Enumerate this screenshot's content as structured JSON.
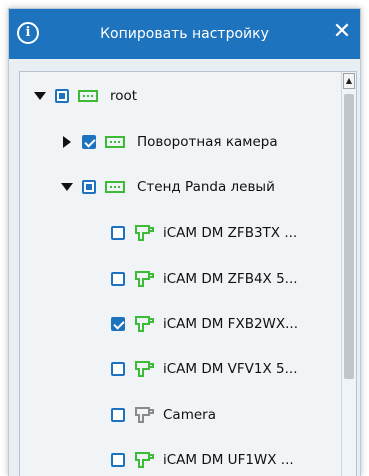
{
  "dialog": {
    "title": "Копировать настройку",
    "info_icon": "info-icon",
    "close_icon": "close-icon",
    "accent_color": "#1e73be",
    "camera_online_color": "#3dbb37",
    "camera_offline_color": "#8a8a8a"
  },
  "tree": {
    "items": [
      {
        "label": "root",
        "level": 0,
        "expander": "expanded",
        "checkbox": "partial",
        "icon": "group-icon"
      },
      {
        "label": "Поворотная камера",
        "level": 1,
        "expander": "collapsed",
        "checkbox": "checked",
        "icon": "group-icon"
      },
      {
        "label": "Стенд Panda левый",
        "level": 1,
        "expander": "expanded",
        "checkbox": "partial",
        "icon": "group-icon"
      },
      {
        "label": "iCAM DM ZFB3TX ...",
        "level": 2,
        "checkbox": "unchecked",
        "icon": "camera-icon",
        "status": "online"
      },
      {
        "label": "iCAM DM ZFB4X 5...",
        "level": 2,
        "checkbox": "unchecked",
        "icon": "camera-icon",
        "status": "online"
      },
      {
        "label": "iCAM DM FXB2WX...",
        "level": 2,
        "checkbox": "checked",
        "icon": "camera-icon",
        "status": "online"
      },
      {
        "label": "iCAM DM VFV1X 5...",
        "level": 2,
        "checkbox": "unchecked",
        "icon": "camera-icon",
        "status": "online"
      },
      {
        "label": "Camera",
        "level": 2,
        "checkbox": "unchecked",
        "icon": "camera-icon",
        "status": "offline"
      },
      {
        "label": "iCAM DM UF1WX ...",
        "level": 2,
        "checkbox": "unchecked",
        "icon": "camera-icon",
        "status": "online"
      }
    ]
  }
}
